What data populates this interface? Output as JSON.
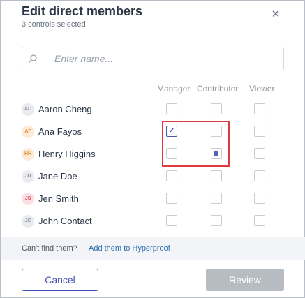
{
  "dialog": {
    "title": "Edit direct members",
    "subtitle": "3 controls selected",
    "close_glyph": "✕"
  },
  "search": {
    "placeholder": "Enter name...",
    "value": ""
  },
  "columns": [
    "Manager",
    "Contributor",
    "Viewer"
  ],
  "members": [
    {
      "initials": "AC",
      "name": "Aaron Cheng",
      "avatar_bg": "#e9ebee",
      "avatar_fg": "#8a919c",
      "manager": "unchecked",
      "contributor": "unchecked",
      "viewer": "unchecked"
    },
    {
      "initials": "AF",
      "name": "Ana Fayos",
      "avatar_bg": "#fdebd8",
      "avatar_fg": "#e08b3a",
      "manager": "checked",
      "contributor": "unchecked",
      "viewer": "unchecked"
    },
    {
      "initials": "HH",
      "name": "Henry Higgins",
      "avatar_bg": "#fdebd8",
      "avatar_fg": "#e08b3a",
      "manager": "unchecked",
      "contributor": "partial",
      "viewer": "unchecked"
    },
    {
      "initials": "JD",
      "name": "Jane Doe",
      "avatar_bg": "#e9ebee",
      "avatar_fg": "#8a919c",
      "manager": "unchecked",
      "contributor": "unchecked",
      "viewer": "unchecked"
    },
    {
      "initials": "JS",
      "name": "Jen Smith",
      "avatar_bg": "#fbe1e4",
      "avatar_fg": "#d9465a",
      "manager": "unchecked",
      "contributor": "unchecked",
      "viewer": "unchecked"
    },
    {
      "initials": "JC",
      "name": "John Contact",
      "avatar_bg": "#e9ebee",
      "avatar_fg": "#8a919c",
      "manager": "unchecked",
      "contributor": "unchecked",
      "viewer": "unchecked"
    }
  ],
  "footer": {
    "note": "Can't find them?",
    "link": "Add them to Hyperproof"
  },
  "buttons": {
    "cancel": "Cancel",
    "review": "Review"
  },
  "colors": {
    "accent": "#3f51b5",
    "highlight": "#e0393e",
    "disabled": "#b7bcc3"
  }
}
